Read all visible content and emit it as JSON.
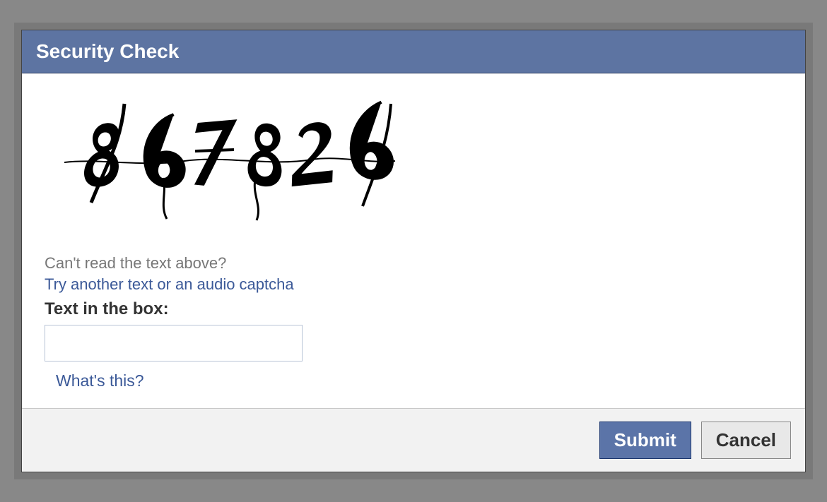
{
  "dialog": {
    "title": "Security Check",
    "captcha_value": "867826",
    "cant_read_label": "Can't read the text above?",
    "try_another_label": "Try another text or an audio captcha",
    "input_label": "Text in the box:",
    "input_value": "",
    "whats_this_label": "What's this?",
    "submit_label": "Submit",
    "cancel_label": "Cancel"
  }
}
